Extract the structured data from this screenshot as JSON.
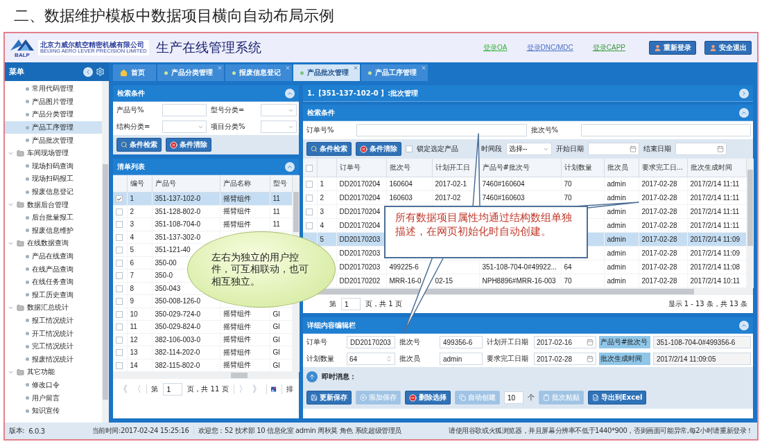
{
  "slide_title": "二、数据维护模板中数据项目横向自动布局示例",
  "header": {
    "logo_text": "BALP",
    "company_name": "北京力威尔航空精密机械有限公司",
    "company_name_en": "BEIJING AERO LEVER PRECISION LIMITED",
    "system_title": "生产在线管理系统",
    "links": [
      {
        "label": "登录OA",
        "color": "#33b233"
      },
      {
        "label": "登录DNC/MDC",
        "color": "#4a6fc4"
      },
      {
        "label": "登录CAPP",
        "color": "#3a9a3a"
      }
    ],
    "buttons": [
      "重新登录",
      "安全退出"
    ]
  },
  "sidebar": {
    "title": "菜单",
    "items": [
      {
        "label": "常用代码管理",
        "selected": false
      },
      {
        "label": "产品图片管理",
        "selected": false
      },
      {
        "label": "产品分类管理",
        "selected": false
      },
      {
        "label": "产品工序管理",
        "selected": true
      },
      {
        "label": "产品批次管理",
        "selected": false
      },
      {
        "label": "车间现场管理",
        "selected": false,
        "expanded": true,
        "children": [
          {
            "label": "现场扫码查询",
            "selected": false
          },
          {
            "label": "现场扫码报工",
            "selected": false
          },
          {
            "label": "报废信息登记",
            "selected": false
          }
        ]
      },
      {
        "label": "数据后台管理",
        "selected": false,
        "expanded": true,
        "children": [
          {
            "label": "后台批量报工",
            "selected": false
          },
          {
            "label": "报废信息维护",
            "selected": false
          }
        ]
      },
      {
        "label": "在线数据查询",
        "selected": false,
        "expanded": true,
        "children": [
          {
            "label": "产品在线查询",
            "selected": false
          },
          {
            "label": "在线产品查询",
            "selected": false
          },
          {
            "label": "在线任务查询",
            "selected": false
          },
          {
            "label": "报工历史查询",
            "selected": false
          }
        ]
      },
      {
        "label": "数据汇总统计",
        "selected": false,
        "expanded": true,
        "children": [
          {
            "label": "报工情况统计",
            "selected": false
          },
          {
            "label": "开工情况统计",
            "selected": false
          },
          {
            "label": "完工情况统计",
            "selected": false
          },
          {
            "label": "报废情况统计",
            "selected": false
          }
        ]
      },
      {
        "label": "其它功能",
        "selected": false,
        "expanded": true,
        "children": [
          {
            "label": "修改口令",
            "selected": false
          },
          {
            "label": "用户留言",
            "selected": false
          },
          {
            "label": "知识宣传",
            "selected": false
          }
        ]
      }
    ]
  },
  "tabs": [
    {
      "label": "首页",
      "kind": "home",
      "closable": false,
      "selected": false
    },
    {
      "label": "产品分类管理",
      "kind": "page",
      "closable": true,
      "selected": false
    },
    {
      "label": "报废信息登记",
      "kind": "page",
      "closable": true,
      "selected": false
    },
    {
      "label": "产品批次管理",
      "kind": "page",
      "closable": true,
      "selected": true
    },
    {
      "label": "产品工序管理",
      "kind": "page",
      "closable": true,
      "selected": false
    }
  ],
  "left_panel": {
    "search": {
      "title": "检索条件",
      "fields": [
        {
          "label": "产品号%",
          "kind": "text"
        },
        {
          "label": "型号分类=",
          "kind": "select"
        },
        {
          "label": "结构分类=",
          "kind": "select"
        },
        {
          "label": "项目分类%",
          "kind": "select"
        }
      ],
      "buttons": [
        {
          "label": "条件检索",
          "kind": "search"
        },
        {
          "label": "条件清除",
          "kind": "clear"
        }
      ]
    },
    "list": {
      "title": "清单列表",
      "columns": [
        "编号",
        "产品号",
        "产品名称",
        "型号"
      ],
      "rows": [
        {
          "cells": [
            "1",
            "351-137-102-0",
            "摇臂组件",
            "11"
          ],
          "checked": true,
          "selected": true
        },
        {
          "cells": [
            "2",
            "351-128-802-0",
            "摇臂组件",
            "11"
          ],
          "checked": false,
          "selected": false
        },
        {
          "cells": [
            "3",
            "351-108-704-0",
            "摇臂组件",
            "11"
          ],
          "checked": false,
          "selected": false
        },
        {
          "cells": [
            "4",
            "351-137-302-0",
            null,
            null
          ],
          "checked": false,
          "selected": false
        },
        {
          "cells": [
            "5",
            "351-121-40",
            null,
            null
          ],
          "checked": false,
          "selected": false
        },
        {
          "cells": [
            "6",
            "350-00",
            null,
            null
          ],
          "checked": false,
          "selected": false
        },
        {
          "cells": [
            "7",
            "350-0",
            null,
            null
          ],
          "checked": false,
          "selected": false
        },
        {
          "cells": [
            "8",
            "350-043",
            null,
            null
          ],
          "checked": false,
          "selected": false
        },
        {
          "cells": [
            "9",
            "350-008-126-0",
            null,
            null
          ],
          "checked": false,
          "selected": false
        },
        {
          "cells": [
            "10",
            "350-029-724-0",
            "摇臂组件",
            "Gl"
          ],
          "checked": false,
          "selected": false
        },
        {
          "cells": [
            "11",
            "350-029-824-0",
            "摇臂组件",
            "Gl"
          ],
          "checked": false,
          "selected": false
        },
        {
          "cells": [
            "12",
            "382-106-003-0",
            "摇臂组件",
            "Gl"
          ],
          "checked": false,
          "selected": false
        },
        {
          "cells": [
            "13",
            "382-114-202-0",
            "摇臂组件",
            "Gl"
          ],
          "checked": false,
          "selected": false
        },
        {
          "cells": [
            "14",
            "382-115-802-0",
            "摇臂组件",
            "Gl"
          ],
          "checked": false,
          "selected": false
        }
      ]
    },
    "pager": {
      "first": "《",
      "prev": "〈",
      "page_prefix": "第",
      "page": "1",
      "page_suffix": "页，共 11 页",
      "next": "〉",
      "last": "》",
      "trailing_text": "排"
    }
  },
  "right_panel": {
    "title": "1.【351-137-102-0 】:批次管理",
    "search": {
      "title": "检索条件",
      "fields": [
        {
          "label": "订单号%"
        },
        {
          "label": "批次号%"
        }
      ],
      "buttons": [
        {
          "label": "条件检索",
          "kind": "search"
        },
        {
          "label": "条件清除",
          "kind": "clear"
        }
      ],
      "lock": {
        "label": "锁定选定产品",
        "checked": false
      },
      "period": {
        "label": "时间段",
        "value": "选择--"
      },
      "start_date": {
        "label": "开始日期"
      },
      "end_date": {
        "label": "结束日期"
      }
    },
    "grid": {
      "select_all": {
        "checked": false
      },
      "columns": [
        "订单号",
        "批次号",
        "计划开工日",
        "产品号#批次号",
        "计划数量",
        "批次员",
        "要求完工日...",
        "批次生成时间"
      ],
      "rows": [
        {
          "num": "1",
          "checked": false,
          "selected": false,
          "cells": [
            "DD20170204",
            "160604",
            "2017-02-1",
            "7460#160604",
            "70",
            "admin",
            "2017-02-28",
            "2017/2/14 11:11"
          ]
        },
        {
          "num": "2",
          "checked": false,
          "selected": false,
          "cells": [
            "DD20170204",
            "160603",
            "2017-02",
            "7460#160603",
            "70",
            "admin",
            "2017-02-28",
            "2017/2/14 11:11"
          ]
        },
        {
          "num": "3",
          "checked": false,
          "selected": false,
          "cells": [
            "DD20170204",
            null,
            null,
            null,
            null,
            "admin",
            "2017-02-28",
            "2017/2/14 11:11"
          ]
        },
        {
          "num": "4",
          "checked": false,
          "selected": false,
          "cells": [
            "DD20170204",
            null,
            null,
            null,
            null,
            "admin",
            "2017-02-28",
            "2017/2/14 11:11"
          ]
        },
        {
          "num": "5",
          "selected": true,
          "cells": [
            "DD20170203",
            null,
            null,
            null,
            null,
            "admin",
            "2017-02-28",
            "2017/2/14 11:09"
          ]
        },
        {
          "num": null,
          "selected": false,
          "cells": [
            "DD20170203",
            null,
            null,
            null,
            null,
            "admin",
            "2017-02-28",
            "2017/2/14 11:09"
          ]
        },
        {
          "num": null,
          "selected": false,
          "cells": [
            "DD20170203",
            "499225-6",
            null,
            "351-108-704-0#49922...",
            "64",
            "admin",
            "2017-02-28",
            "2017/2/14 11:08"
          ]
        },
        {
          "num": null,
          "selected": false,
          "cells": [
            "DD20170202",
            "MRR-16-0",
            "02-15",
            "NPH8896#MRR-16-003",
            "70",
            "admin",
            "2017-02-28",
            "2017/2/14 10:11"
          ]
        }
      ]
    },
    "pager": {
      "page_prefix": "第",
      "page": "1",
      "page_suffix": "页，共 1 页",
      "summary": "显示 1 - 13 条，共 13 条"
    },
    "detail": {
      "title": "详细内容编辑栏",
      "fields": [
        {
          "label": "订单号",
          "value": "DD20170203",
          "kind": "text"
        },
        {
          "label": "批次号",
          "value": "499356-6",
          "kind": "text"
        },
        {
          "label": "计划开工日期",
          "value": "2017-02-16",
          "kind": "date"
        },
        {
          "label": "产品号#批次号",
          "value": "351-108-704-0#499356-6",
          "kind": "readonly"
        },
        {
          "label": "计划数量",
          "value": "64",
          "kind": "number"
        },
        {
          "label": "批次员",
          "value": "admin",
          "kind": "text"
        },
        {
          "label": "要求完工日期",
          "value": "2017-02-28",
          "kind": "date"
        },
        {
          "label": "批次生成时间",
          "value": "2017/2/14 11:09:05",
          "kind": "readonly"
        }
      ]
    },
    "message": {
      "label": "即时消息："
    },
    "actions": [
      {
        "kind": "save",
        "label": "更新保存",
        "disabled": false
      },
      {
        "kind": "add",
        "label": "添加保存",
        "disabled": true
      },
      {
        "kind": "delete",
        "label": "删除选择",
        "disabled": false
      },
      {
        "kind": "auto",
        "label": "自动创建",
        "disabled": true
      },
      {
        "kind": "count",
        "value": "10",
        "unit": "个"
      },
      {
        "kind": "paste",
        "label": "批次粘贴",
        "disabled": true
      },
      {
        "kind": "export",
        "label": "导出到Excel",
        "disabled": false
      }
    ]
  },
  "status_bar": {
    "version_label": "版本:",
    "version": "6.0.3",
    "time": "当前时间:2017-02-24 15:25:16",
    "user": "欢迎您：52 技术部 10 信息化室 admin 周秋莫  角色 系统超级管理员",
    "notice": "请使用谷歌或火狐浏览器，并且屏幕分辨率不低于1440*900，否则画面可能异常,每2小时请重新登录！"
  },
  "callouts": [
    {
      "kind": "bubble",
      "text": "左右为独立的用户控件，可互相联动，也可相互独立。"
    },
    {
      "kind": "box",
      "text": "所有数据项目属性均通过结构数组单独描述，在网页初始化时自动创建。"
    }
  ]
}
